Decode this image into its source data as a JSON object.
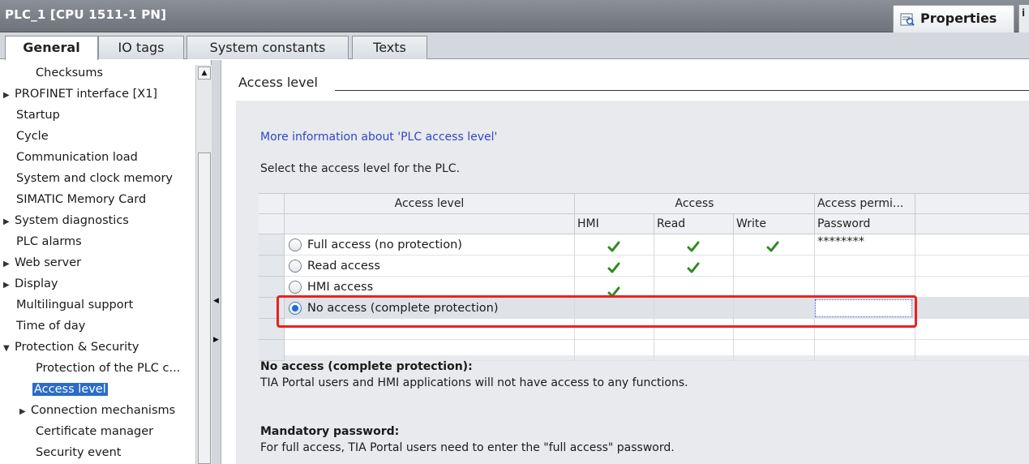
{
  "window": {
    "title": "PLC_1 [CPU 1511-1 PN]",
    "properties_label": "Properties",
    "corner_glyph": "i"
  },
  "tabs": [
    {
      "label": "General",
      "active": true
    },
    {
      "label": "IO tags",
      "active": false
    },
    {
      "label": "System constants",
      "active": false
    },
    {
      "label": "Texts",
      "active": false
    }
  ],
  "nav": {
    "items": [
      {
        "label": "Checksums",
        "arrow": "",
        "selected": false
      },
      {
        "label": "PROFINET interface [X1]",
        "arrow": "▶",
        "selected": false
      },
      {
        "label": "Startup",
        "arrow": "",
        "selected": false
      },
      {
        "label": "Cycle",
        "arrow": "",
        "selected": false
      },
      {
        "label": "Communication load",
        "arrow": "",
        "selected": false
      },
      {
        "label": "System and clock memory",
        "arrow": "",
        "selected": false
      },
      {
        "label": "SIMATIC Memory Card",
        "arrow": "",
        "selected": false
      },
      {
        "label": "System diagnostics",
        "arrow": "▶",
        "selected": false
      },
      {
        "label": "PLC alarms",
        "arrow": "",
        "selected": false
      },
      {
        "label": "Web server",
        "arrow": "▶",
        "selected": false
      },
      {
        "label": "Display",
        "arrow": "▶",
        "selected": false
      },
      {
        "label": "Multilingual support",
        "arrow": "",
        "selected": false
      },
      {
        "label": "Time of day",
        "arrow": "",
        "selected": false
      },
      {
        "label": "Protection & Security",
        "arrow": "▼",
        "selected": false
      },
      {
        "label": "Protection of the PLC c...",
        "arrow": "",
        "selected": false
      },
      {
        "label": "Access level",
        "arrow": "",
        "selected": true
      },
      {
        "label": "Connection mechanisms",
        "arrow": "▶",
        "selected": false
      },
      {
        "label": "Certificate manager",
        "arrow": "",
        "selected": false
      },
      {
        "label": "Security event",
        "arrow": "",
        "selected": false
      }
    ]
  },
  "main": {
    "section_title": "Access level",
    "more_info_link": "More information about 'PLC access level'",
    "instruction": "Select the access level for the PLC.",
    "table": {
      "header_groups": {
        "access_level": "Access level",
        "access": "Access",
        "access_permission": "Access permi..."
      },
      "sub_headers": {
        "hmi": "HMI",
        "read": "Read",
        "write": "Write",
        "password": "Password"
      },
      "rows": [
        {
          "label": "Full access (no protection)",
          "selected": false,
          "hmi": true,
          "read": true,
          "write": true,
          "password": "********"
        },
        {
          "label": "Read access",
          "selected": false,
          "hmi": true,
          "read": true,
          "write": false,
          "password": ""
        },
        {
          "label": "HMI access",
          "selected": false,
          "hmi": true,
          "read": false,
          "write": false,
          "password": ""
        },
        {
          "label": "No access (complete protection)",
          "selected": true,
          "hmi": false,
          "read": false,
          "write": false,
          "password": ""
        }
      ]
    },
    "description": {
      "title": "No access (complete protection):",
      "text": "TIA Portal users and HMI applications will not have access to any functions."
    },
    "mandatory": {
      "title": "Mandatory password:",
      "text": "For full access, TIA Portal users need to enter the \"full access\" password."
    }
  },
  "colors": {
    "check": "#2e8b1f",
    "highlight": "#e8231f",
    "link": "#2e47c9",
    "selection": "#2a6cc8"
  }
}
